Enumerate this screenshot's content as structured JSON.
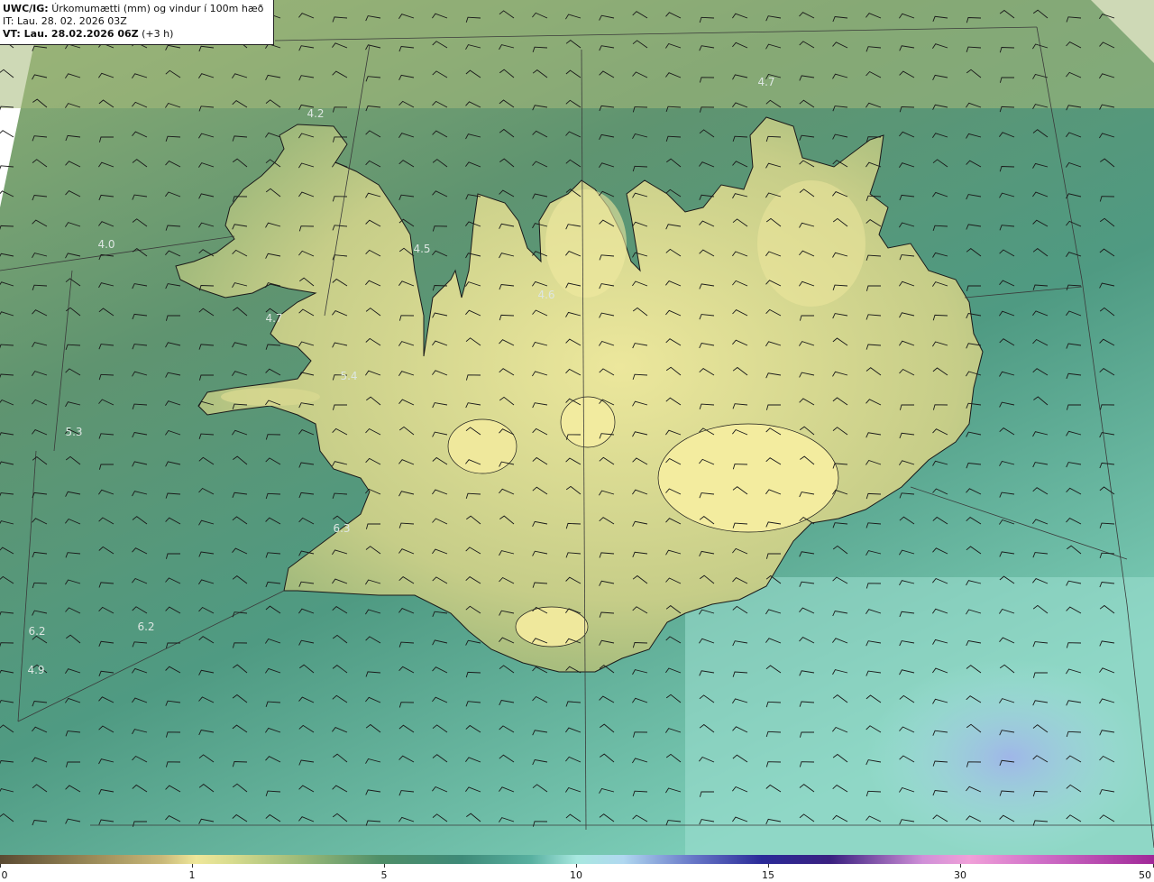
{
  "header": {
    "model": "UWC/IG:",
    "product": "Úrkomumætti (mm) og vindur í 100m hæð",
    "issue_time": "IT: Lau. 28. 02. 2026 03Z",
    "valid_label": "VT: Lau. 28.02.2026 06Z",
    "lead": "(+3 h)"
  },
  "map_values": [
    "4.7",
    "4.2",
    "4.0",
    "4.5",
    "4.6",
    "4.7",
    "5.4",
    "5.3",
    "6.3",
    "6.2",
    "6.2",
    "4.9"
  ],
  "colorbar": {
    "ticks": [
      "0",
      "1",
      "5",
      "10",
      "15",
      "30",
      "50"
    ]
  },
  "colors": {
    "ocean_north": "#6f9a6a",
    "ocean_south": "#52a88e",
    "land_high": "#e8e59a",
    "coastline": "#1a1a1a",
    "wind_barb": "#1a1a1a"
  }
}
